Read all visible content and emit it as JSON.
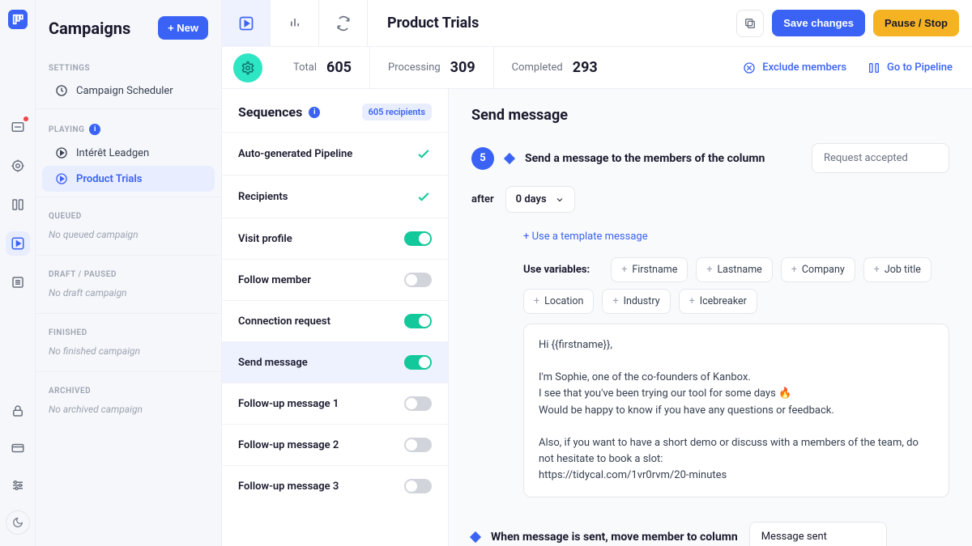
{
  "sidebar": {
    "title": "Campaigns",
    "new_btn": "+ New",
    "sections": {
      "settings": "SETTINGS",
      "playing": "PLAYING",
      "queued": "QUEUED",
      "draft": "DRAFT / PAUSED",
      "finished": "FINISHED",
      "archived": "ARCHIVED"
    },
    "scheduler": "Campaign Scheduler",
    "playing_items": [
      "Intérêt Leadgen",
      "Product Trials"
    ],
    "empty": {
      "queued": "No queued campaign",
      "draft": "No draft campaign",
      "finished": "No finished campaign",
      "archived": "No archived campaign"
    }
  },
  "topbar": {
    "title": "Product Trials",
    "save": "Save changes",
    "pause": "Pause / Stop"
  },
  "stats": {
    "total_label": "Total",
    "total": "605",
    "processing_label": "Processing",
    "processing": "309",
    "completed_label": "Completed",
    "completed": "293",
    "exclude": "Exclude members",
    "pipeline": "Go to Pipeline"
  },
  "sequences": {
    "title": "Sequences",
    "badge": "605 recipients",
    "items": [
      {
        "label": "Auto-generated Pipeline",
        "state": "check"
      },
      {
        "label": "Recipients",
        "state": "check"
      },
      {
        "label": "Visit profile",
        "state": "on"
      },
      {
        "label": "Follow member",
        "state": "off"
      },
      {
        "label": "Connection request",
        "state": "on"
      },
      {
        "label": "Send message",
        "state": "on",
        "active": true
      },
      {
        "label": "Follow-up message 1",
        "state": "off"
      },
      {
        "label": "Follow-up message 2",
        "state": "off"
      },
      {
        "label": "Follow-up message 3",
        "state": "off"
      }
    ]
  },
  "editor": {
    "title": "Send message",
    "step_num": "5",
    "step_text": "Send a message to the members of the column",
    "column_value": "Request accepted",
    "after_label": "after",
    "after_value": "0 days",
    "template_link": "+ Use a template message",
    "vars_label": "Use variables:",
    "vars": [
      "Firstname",
      "Lastname",
      "Company",
      "Job title",
      "Location",
      "Industry",
      "Icebreaker"
    ],
    "message": "Hi {{firstname}},\n\nI'm Sophie, one of the co-founders of Kanbox.\nI see that you've been trying our tool for some days 🔥\nWould be happy to know if you have any questions or feedback.\n\nAlso, if you want to have a short demo or discuss with a members of the team, do not hesitate to book a slot:\nhttps://tidycal.com/1vr0rvm/20-minutes",
    "move_text": "When message is sent, move member to column",
    "move_value": "Message sent"
  }
}
